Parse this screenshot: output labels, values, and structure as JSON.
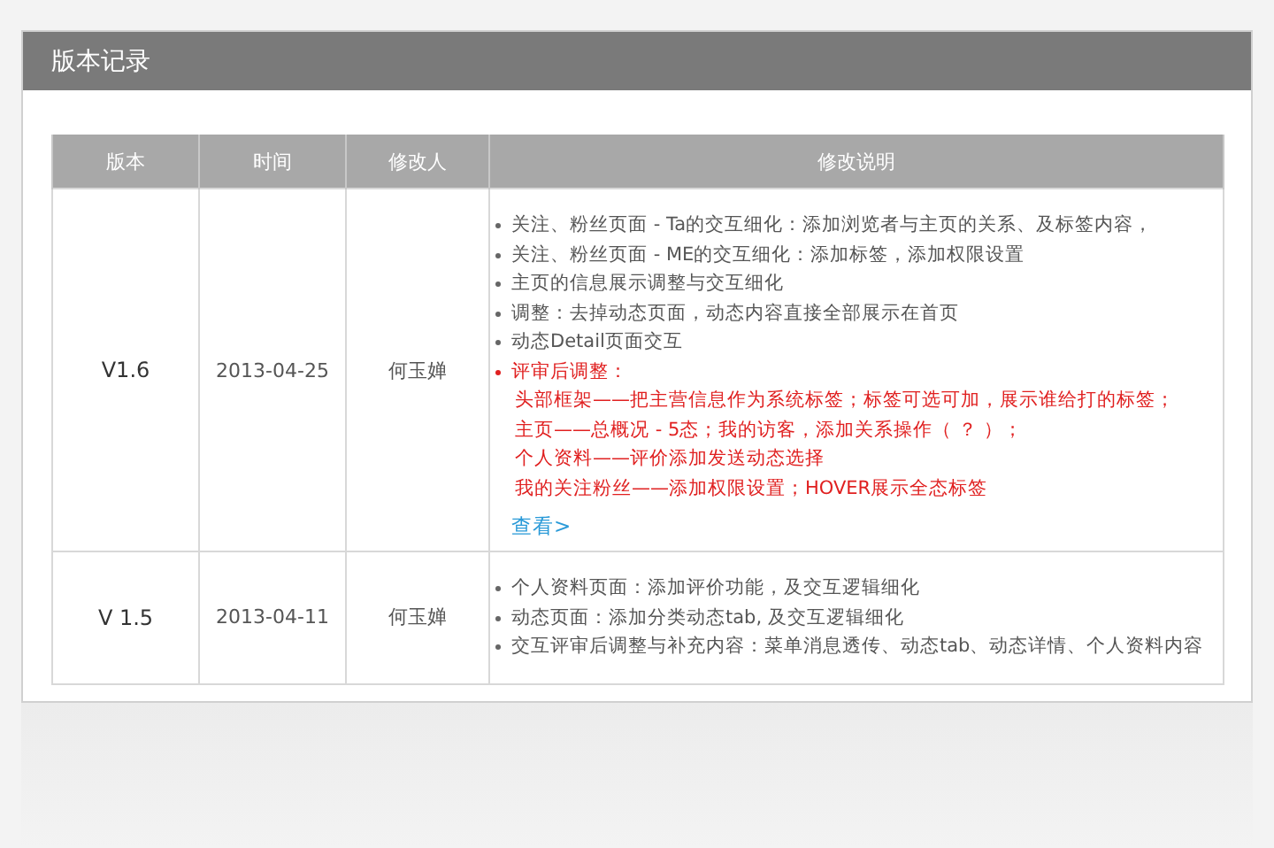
{
  "panel": {
    "title": "版本记录"
  },
  "table": {
    "columns": [
      "版本",
      "时间",
      "修改人",
      "修改说明"
    ],
    "rows": [
      {
        "version": "V1.6",
        "date": "2013-04-25",
        "author": "何玉婵",
        "notes": [
          {
            "kind": "normal",
            "text": "关注、粉丝页面 - Ta的交互细化：添加浏览者与主页的关系、及标签内容，"
          },
          {
            "kind": "normal",
            "text": "关注、粉丝页面 - ME的交互细化：添加标签，添加权限设置"
          },
          {
            "kind": "normal",
            "text": "主页的信息展示调整与交互细化"
          },
          {
            "kind": "normal",
            "text": "调整：去掉动态页面，动态内容直接全部展示在首页"
          },
          {
            "kind": "normal",
            "text": "动态Detail页面交互"
          },
          {
            "kind": "highlight",
            "text": "评审后调整：",
            "children": [
              {
                "text": "头部框架——把主营信息作为系统标签；标签可选可加，展示谁给打的标签；"
              },
              {
                "text": "主页——总概况 - 5态；我的访客，添加关系操作（ ？ ）；"
              },
              {
                "text": "个人资料——评价添加发送动态选择"
              },
              {
                "text": "我的关注粉丝——添加权限设置；HOVER展示全态标签"
              }
            ]
          }
        ],
        "link": "查看>"
      },
      {
        "version": "V 1.5",
        "date": "2013-04-11",
        "author": "何玉婵",
        "notes": [
          {
            "kind": "normal",
            "text": "个人资料页面：添加评价功能，及交互逻辑细化"
          },
          {
            "kind": "normal",
            "text": "动态页面：添加分类动态tab, 及交互逻辑细化"
          },
          {
            "kind": "normal",
            "text": "交互评审后调整与补充内容：菜单消息透传、动态tab、动态详情、个人资料内容"
          }
        ]
      }
    ]
  }
}
